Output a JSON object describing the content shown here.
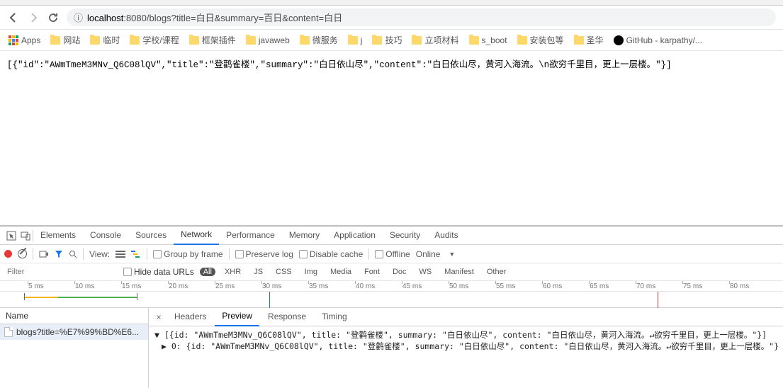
{
  "address": {
    "scheme_icon": "ⓘ",
    "host": "localhost",
    "port_path": ":8080/blogs?title=白日&summary=百日&content=白日"
  },
  "bookmarks": {
    "apps_label": "Apps",
    "items": [
      "网站",
      "临时",
      "学校/课程",
      "框架插件",
      "javaweb",
      "微服务",
      "j",
      "技巧",
      "立项材料",
      "s_boot",
      "安装包等",
      "圣华"
    ],
    "github": "GitHub - karpathy/..."
  },
  "page_content": "[{\"id\":\"AWmTmeM3MNv_Q6C08lQV\",\"title\":\"登鹳雀楼\",\"summary\":\"白日依山尽\",\"content\":\"白日依山尽，黄河入海流。\\n欲穷千里目，更上一层楼。\"}]",
  "devtools": {
    "tabs": [
      "Elements",
      "Console",
      "Sources",
      "Network",
      "Performance",
      "Memory",
      "Application",
      "Security",
      "Audits"
    ],
    "active_tab": "Network",
    "toolbar": {
      "view_label": "View:",
      "group_by_frame": "Group by frame",
      "preserve_log": "Preserve log",
      "disable_cache": "Disable cache",
      "offline": "Offline",
      "throttle": "Online"
    },
    "filter": {
      "placeholder": "Filter",
      "hide_data_urls": "Hide data URLs",
      "types": [
        "All",
        "XHR",
        "JS",
        "CSS",
        "Img",
        "Media",
        "Font",
        "Doc",
        "WS",
        "Manifest",
        "Other"
      ],
      "active_type": "All"
    },
    "timeline_ticks": [
      "5 ms",
      "10 ms",
      "15 ms",
      "20 ms",
      "25 ms",
      "30 ms",
      "35 ms",
      "40 ms",
      "45 ms",
      "50 ms",
      "55 ms",
      "60 ms",
      "65 ms",
      "70 ms",
      "75 ms",
      "80 ms"
    ],
    "network": {
      "name_header": "Name",
      "request_name": "blogs?title=%E7%99%BD%E6...",
      "detail_tabs": [
        "Headers",
        "Preview",
        "Response",
        "Timing"
      ],
      "active_detail_tab": "Preview",
      "preview_line1": "▼ [{id: \"AWmTmeM3MNv_Q6C08lQV\", title: \"登鹳雀楼\", summary: \"白日依山尽\", content: \"白日依山尽，黄河入海流。↵欲穷千里目，更上一层楼。\"}]",
      "preview_line2": "  ▶ 0: {id: \"AWmTmeM3MNv_Q6C08lQV\", title: \"登鹳雀楼\", summary: \"白日依山尽\", content: \"白日依山尽，黄河入海流。↵欲穷千里目，更上一层楼。\"}"
    }
  }
}
